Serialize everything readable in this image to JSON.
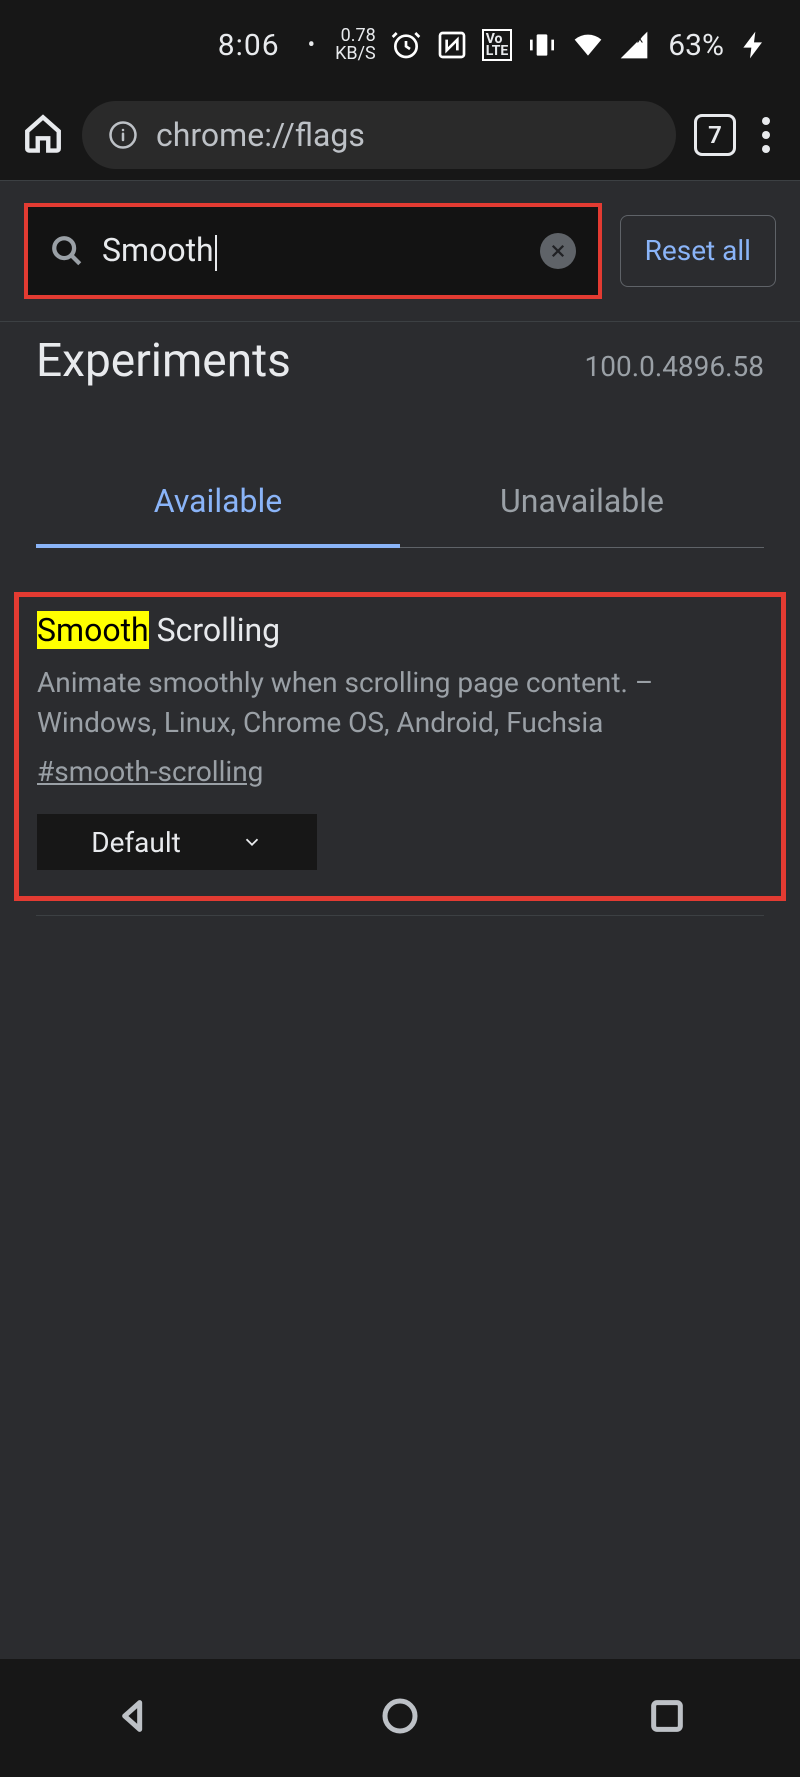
{
  "status": {
    "time": "8:06",
    "net_speed_top": "0.78",
    "net_speed_bottom": "KB/S",
    "lte": "Vo\nLTE",
    "battery": "63%"
  },
  "browser": {
    "url": "chrome://flags",
    "tab_count": "7"
  },
  "flags": {
    "search_value": "Smooth",
    "reset_label": "Reset all",
    "heading": "Experiments",
    "version": "100.0.4896.58",
    "tab_available": "Available",
    "tab_unavailable": "Unavailable",
    "item": {
      "title_highlight": "Smooth",
      "title_rest": " Scrolling",
      "description": "Animate smoothly when scrolling page content. – Windows, Linux, Chrome OS, Android, Fuchsia",
      "anchor": "#smooth-scrolling",
      "select_value": "Default"
    }
  }
}
